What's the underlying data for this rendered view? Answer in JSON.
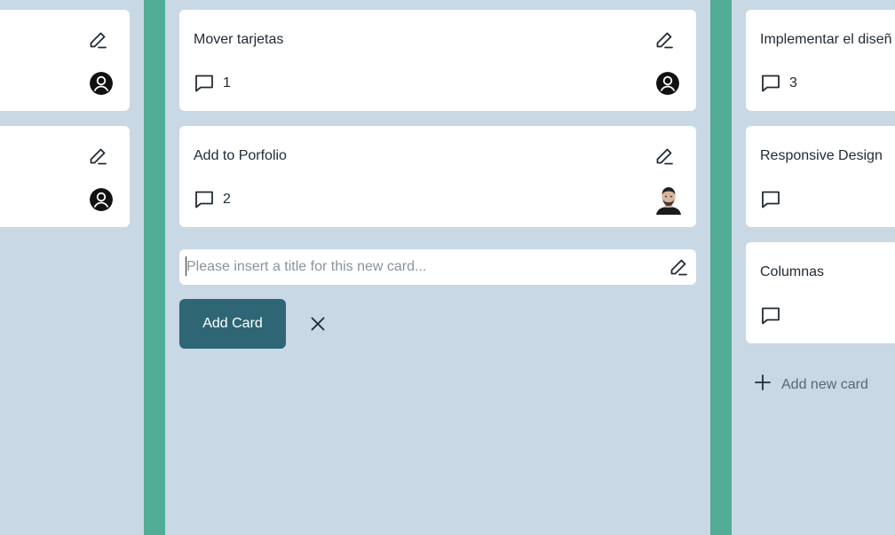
{
  "left_column": {
    "cards": [
      {
        "has_edit": true,
        "avatar": "default-avatar"
      },
      {
        "has_edit": true,
        "avatar": "default-avatar"
      }
    ]
  },
  "middle_column": {
    "cards": [
      {
        "title": "Mover tarjetas",
        "comment_count": "1",
        "avatar": "default-avatar"
      },
      {
        "title": "Add to Porfolio",
        "comment_count": "2",
        "avatar": "user-photo-avatar"
      }
    ],
    "new_card_form": {
      "placeholder": "Please insert a title for this new card...",
      "value": "",
      "add_label": "Add Card",
      "close_icon": "close-icon"
    }
  },
  "right_column": {
    "cards": [
      {
        "title": "Implementar el diseñ",
        "comment_count": "3"
      },
      {
        "title": "Responsive Design",
        "comment_count": ""
      },
      {
        "title": "Columnas",
        "comment_count": ""
      }
    ],
    "add_new_card_label": "Add new card"
  },
  "colors": {
    "board_background": "#c8d8e4",
    "column_divider": "#52ac96",
    "card_background": "#ffffff",
    "primary_button": "#2e6675",
    "text": "#222b35"
  }
}
